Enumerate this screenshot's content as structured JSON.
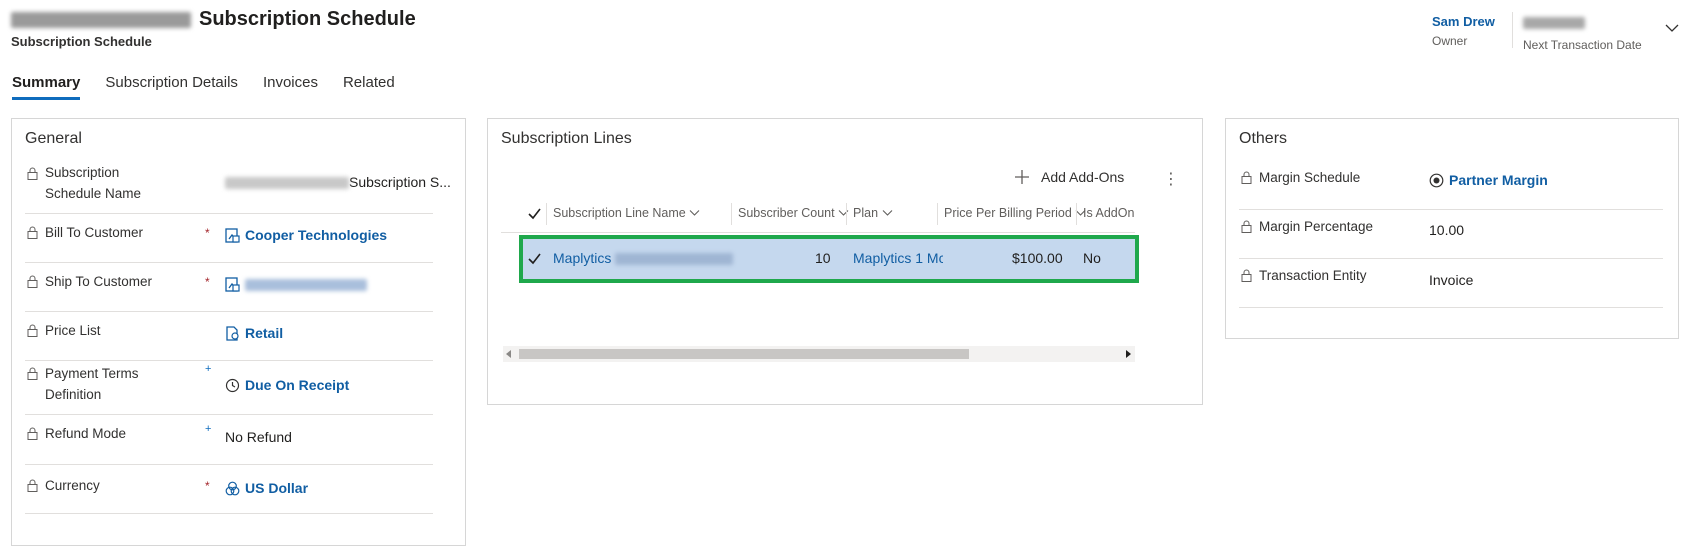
{
  "header": {
    "title": "Subscription Schedule",
    "entity_type": "Subscription Schedule",
    "owner": {
      "value": "Sam Drew",
      "label": "Owner"
    },
    "next_transaction_date": {
      "label": "Next Transaction Date"
    }
  },
  "tabs": [
    {
      "label": "Summary",
      "active": true
    },
    {
      "label": "Subscription Details"
    },
    {
      "label": "Invoices"
    },
    {
      "label": "Related"
    }
  ],
  "general": {
    "title": "General",
    "fields": [
      {
        "label": "Subscription Schedule Name",
        "label_line1": "Subscription",
        "label_line2": "Schedule Name",
        "value": "Subscription S...",
        "required": ""
      },
      {
        "label": "Bill To Customer",
        "value": "Cooper Technologies",
        "required": "*",
        "icon": "account-icon"
      },
      {
        "label": "Ship To Customer",
        "value": "",
        "required": "*",
        "icon": "account-icon"
      },
      {
        "label": "Price List",
        "value": "Retail",
        "icon": "price-list-icon"
      },
      {
        "label": "Payment Terms Definition",
        "label_line1": "Payment Terms",
        "label_line2": "Definition",
        "value": "Due On Receipt",
        "recommended": "+",
        "icon": "clock-icon"
      },
      {
        "label": "Refund Mode",
        "value": "No Refund",
        "recommended": "+"
      },
      {
        "label": "Currency",
        "value": "US Dollar",
        "required": "*",
        "icon": "currency-icon"
      }
    ]
  },
  "subscription_lines": {
    "title": "Subscription Lines",
    "add_addons_label": "Add Add-Ons",
    "columns": [
      "Subscription Line Name",
      "Subscriber Count",
      "Plan",
      "Price Per Billing Period",
      "Is AddOn"
    ],
    "rows": [
      {
        "name": "Maplytics",
        "subscriber_count": "10",
        "plan": "Maplytics 1 Mc",
        "price": "$100.00",
        "is_addon": "No",
        "selected": true
      }
    ]
  },
  "others": {
    "title": "Others",
    "fields": [
      {
        "label": "Margin Schedule",
        "value": "Partner Margin",
        "icon": "margin-icon"
      },
      {
        "label": "Margin Percentage",
        "value": "10.00"
      },
      {
        "label": "Transaction Entity",
        "value": "Invoice"
      }
    ]
  },
  "colors": {
    "accent": "#0f6cbd",
    "link": "#115ea3",
    "selection_outline": "#1fa84c",
    "selected_row": "#c5d8ee"
  }
}
